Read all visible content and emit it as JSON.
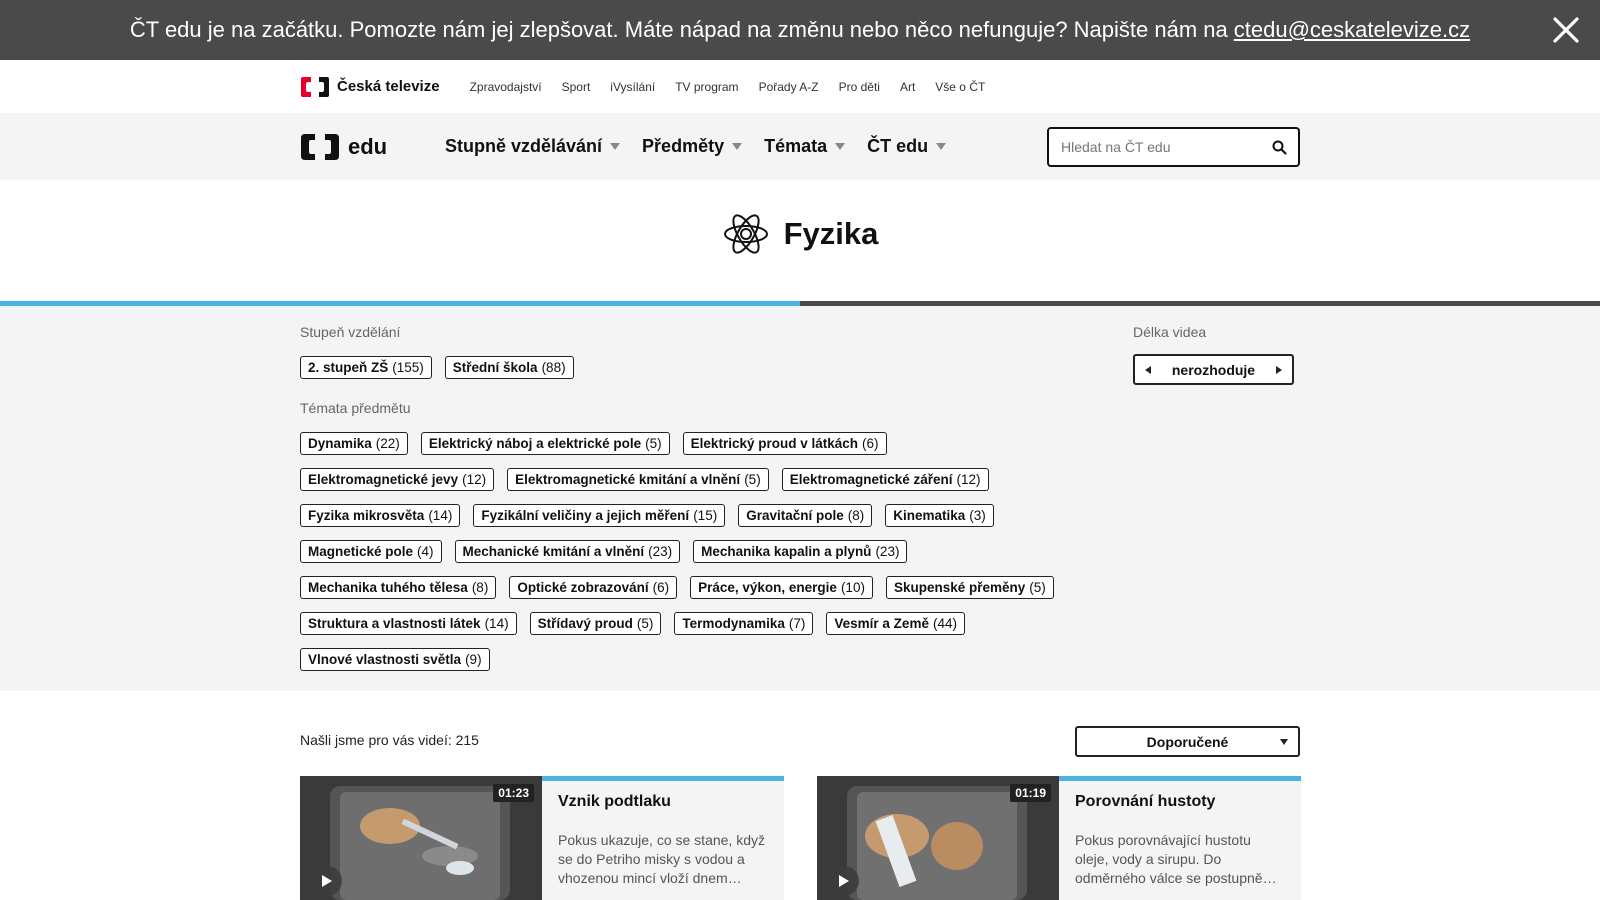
{
  "notice": {
    "text": "ČT edu je na začátku. Pomozte nám jej zlepšovat. Máte nápad na změnu nebo něco nefunguje? Napište nám na",
    "email": "ctedu@ceskatelevize.cz"
  },
  "ct_header": {
    "brand": "Česká televize",
    "links": [
      "Zpravodajství",
      "Sport",
      "iVysílání",
      "TV program",
      "Pořady A-Z",
      "Pro děti",
      "Art",
      "Vše o ČT"
    ]
  },
  "edu_header": {
    "logo_text": "edu",
    "menu": [
      "Stupně vzdělávání",
      "Předměty",
      "Témata",
      "ČT edu"
    ],
    "search_placeholder": "Hledat na ČT edu"
  },
  "page": {
    "title": "Fyzika",
    "title_icon": "atom-icon",
    "progress_fraction": 0.5
  },
  "filters": {
    "level_label": "Stupeň vzdělání",
    "levels": [
      {
        "label": "2. stupeň ZŠ",
        "count": "(155)"
      },
      {
        "label": "Střední škola",
        "count": "(88)"
      }
    ],
    "topics_label": "Témata předmětu",
    "topics": [
      {
        "label": "Dynamika",
        "count": "(22)"
      },
      {
        "label": "Elektrický náboj a elektrické pole",
        "count": "(5)"
      },
      {
        "label": "Elektrický proud v látkách",
        "count": "(6)"
      },
      {
        "label": "Elektromagnetické jevy",
        "count": "(12)"
      },
      {
        "label": "Elektromagnetické kmitání a vlnění",
        "count": "(5)"
      },
      {
        "label": "Elektromagnetické záření",
        "count": "(12)"
      },
      {
        "label": "Fyzika mikrosvěta",
        "count": "(14)"
      },
      {
        "label": "Fyzikální veličiny a jejich měření",
        "count": "(15)"
      },
      {
        "label": "Gravitační pole",
        "count": "(8)"
      },
      {
        "label": "Kinematika",
        "count": "(3)"
      },
      {
        "label": "Magnetické pole",
        "count": "(4)"
      },
      {
        "label": "Mechanické kmitání a vlnění",
        "count": "(23)"
      },
      {
        "label": "Mechanika kapalin a plynů",
        "count": "(23)"
      },
      {
        "label": "Mechanika tuhého tělesa",
        "count": "(8)"
      },
      {
        "label": "Optické zobrazování",
        "count": "(6)"
      },
      {
        "label": "Práce, výkon, energie",
        "count": "(10)"
      },
      {
        "label": "Skupenské přeměny",
        "count": "(5)"
      },
      {
        "label": "Struktura a vlastnosti látek",
        "count": "(14)"
      },
      {
        "label": "Střídavý proud",
        "count": "(5)"
      },
      {
        "label": "Termodynamika",
        "count": "(7)"
      },
      {
        "label": "Vesmír a Země",
        "count": "(44)"
      },
      {
        "label": "Vlnové vlastnosti světla",
        "count": "(9)"
      }
    ],
    "duration_label": "Délka videa",
    "duration_value": "nerozhoduje"
  },
  "results": {
    "count_text": "Našli jsme pro vás videí: 215",
    "sort_value": "Doporučené",
    "cards": [
      {
        "duration": "01:23",
        "title": "Vznik podtlaku",
        "description": "Pokus ukazuje, co se stane, když se do Petriho misky s vodou a vhozenou mincí vloží dnem…"
      },
      {
        "duration": "01:19",
        "title": "Porovnání hustoty",
        "description": "Pokus porovnávající hustotu oleje, vody a sirupu. Do odměrného válce se postupně…"
      }
    ]
  },
  "colors": {
    "accent": "#4bb3df",
    "notice_bg": "#4a4a4a",
    "panel_bg": "#f4f4f4",
    "ct_red": "#e4002b"
  }
}
